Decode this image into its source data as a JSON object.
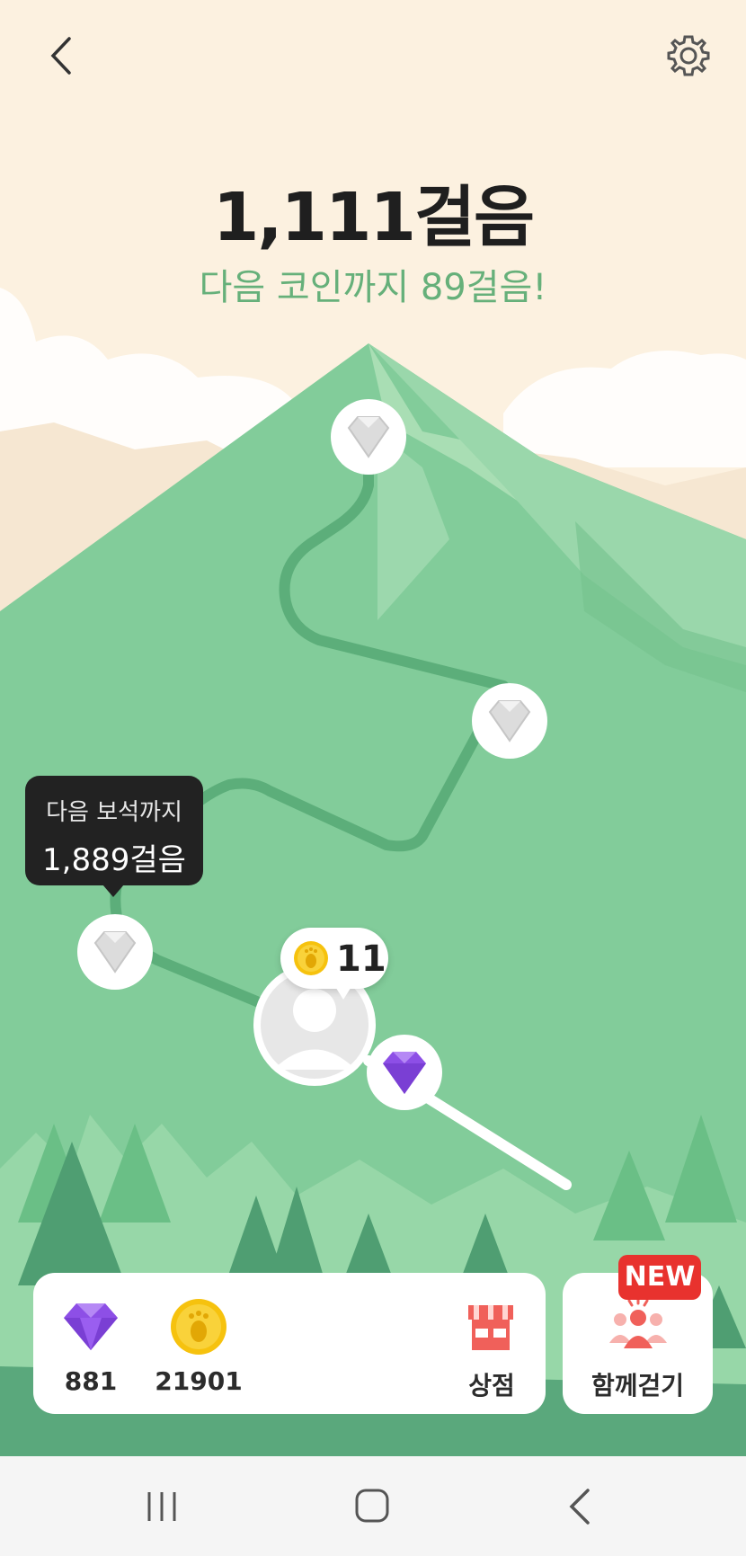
{
  "header": {
    "back_icon": "chevron-left-icon",
    "settings_icon": "gear-icon"
  },
  "steps": {
    "title": "1,111걸음",
    "next_coin": "다음 코인까지 89걸음!"
  },
  "tooltip": {
    "line1": "다음 보석까지",
    "line2": "1,889걸음"
  },
  "coin_bubble": {
    "count": "11",
    "icon": "footprint-coin-icon"
  },
  "bottom": {
    "gems": "881",
    "coins": "21901",
    "shop_label": "상점",
    "walk_together_label": "함께걷기",
    "new_badge": "NEW"
  },
  "colors": {
    "background": "#fcf1e0",
    "mountain": "#82cc9a",
    "path": "#5cae7a",
    "accent_green": "#66b07a",
    "gem_purple": "#8d4fe6",
    "coin_gold": "#f6c20e",
    "badge_red": "#e8322e"
  },
  "system_nav": {
    "recent_icon": "recent-apps-icon",
    "home_icon": "home-icon",
    "back_icon": "back-icon"
  }
}
